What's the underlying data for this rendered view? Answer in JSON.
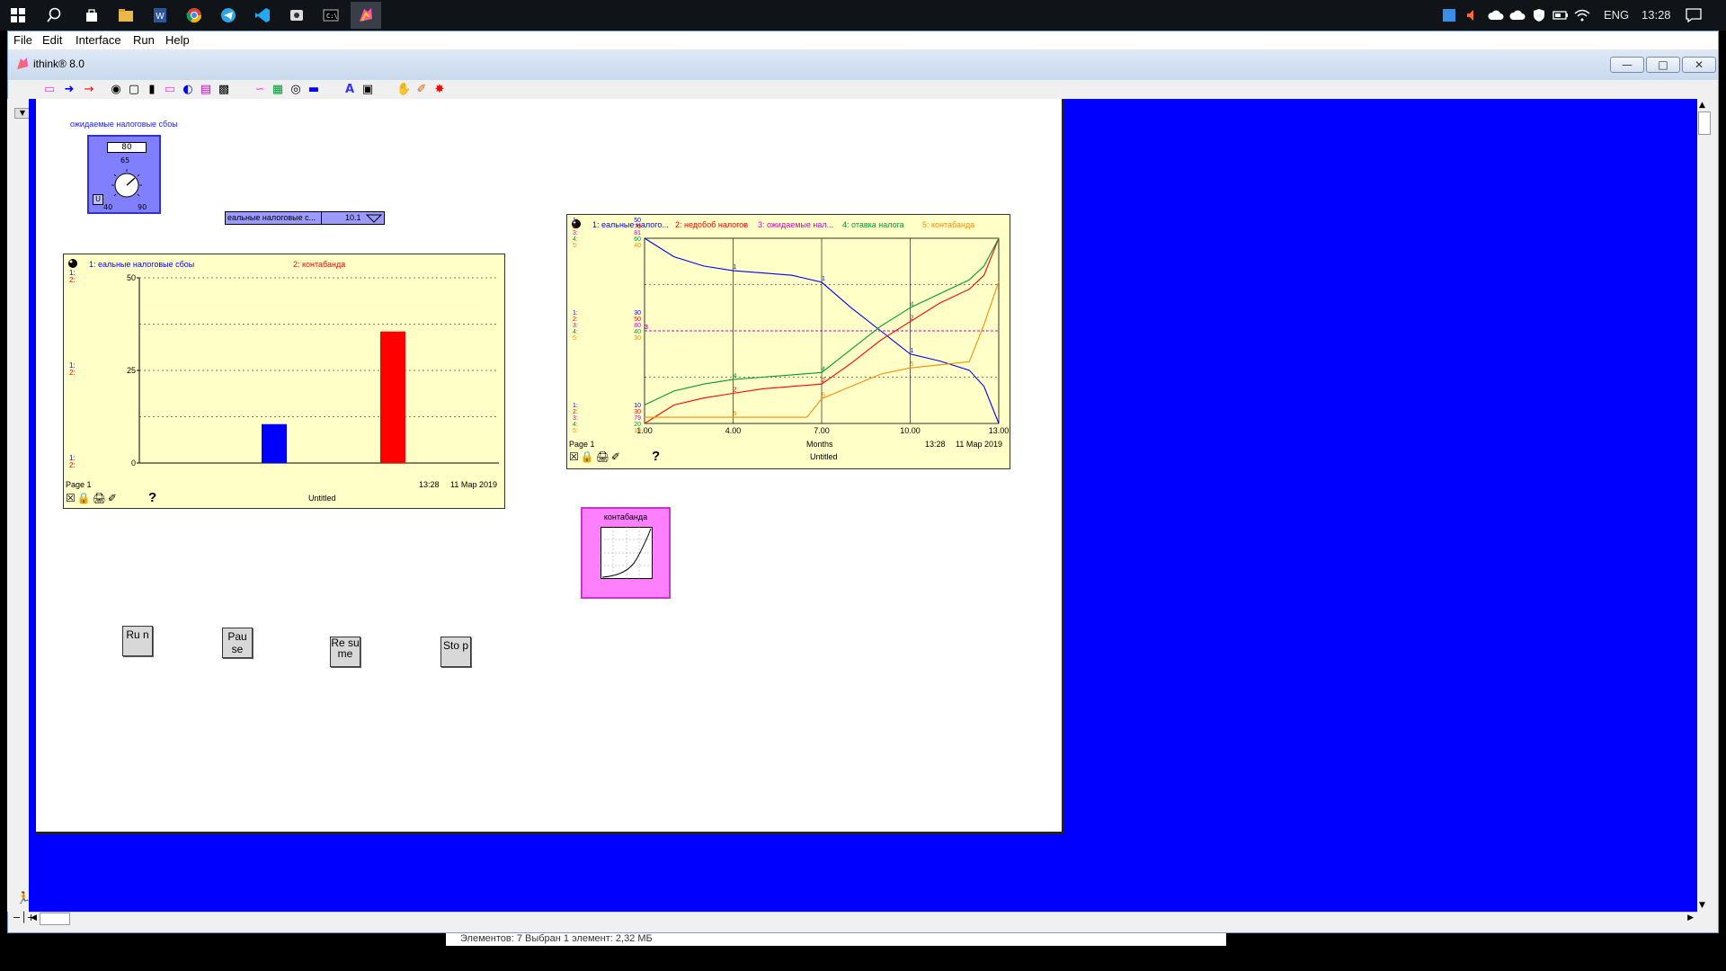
{
  "taskbar": {
    "tray_lang": "ENG",
    "tray_time": "13:28"
  },
  "menubar": {
    "file": "File",
    "edit": "Edit",
    "interface": "Interface",
    "run": "Run",
    "help": "Help"
  },
  "window": {
    "title": "ithink® 8.0"
  },
  "knob": {
    "label": "ожидаемые налоговые сбоы",
    "value": "80",
    "mid": "65",
    "min": "40",
    "max": "90",
    "unit_btn": "U"
  },
  "dropdown": {
    "label": "еальные налоговые с...",
    "value": "10.1"
  },
  "bar_graph": {
    "legend1": "1: еальные налоговые сбоы",
    "legend2": "2: контабанда",
    "page": "Page 1",
    "time": "13:28",
    "date": "11 Мар 2019",
    "name": "Untitled",
    "help": "?",
    "y_ticks": [
      "50",
      "25",
      "0"
    ],
    "ax_1": "1:",
    "ax_2": "2:",
    "chart_data": {
      "type": "bar",
      "categories": [
        "1",
        "2"
      ],
      "values": [
        10.5,
        35.5
      ],
      "ylim": [
        0,
        50
      ]
    }
  },
  "line_graph": {
    "legend1": "1: еальные налого...",
    "legend2": "2: недобоб налогов",
    "legend3": "3: ожидаемые нал...",
    "legend4": "4: отавка налога",
    "legend5": "5: контабанда",
    "page": "Page 1",
    "time": "13:28",
    "date": "11 Мар 2019",
    "name": "Untitled",
    "xlabel": "Months",
    "help": "?",
    "x_ticks": [
      "1.00",
      "4.00",
      "7.00",
      "10.00",
      "13.00"
    ],
    "top_ticks": [
      "50",
      "70",
      "81",
      "60",
      "40"
    ],
    "mid_ticks": [
      "30",
      "50",
      "80",
      "40",
      "30"
    ],
    "bot_ticks": [
      "10",
      "30",
      "79",
      "20",
      "10"
    ],
    "ax": [
      "1:",
      "2:",
      "3:",
      "4:",
      "5:"
    ],
    "colors": [
      "#0000ff",
      "#ff0000",
      "#cc00cc",
      "#009933",
      "#ff8800"
    ],
    "chart_data": {
      "type": "line",
      "xlim": [
        1,
        13
      ],
      "series": [
        {
          "name": "еальные налого...",
          "x": [
            1,
            2,
            3,
            4,
            5,
            6,
            7,
            8,
            9,
            10,
            11,
            12,
            12.5,
            13
          ],
          "y": [
            50,
            46,
            44,
            43,
            42.5,
            42,
            40.5,
            35,
            30,
            25,
            23.5,
            21.5,
            18,
            10
          ]
        },
        {
          "name": "недобоб налогов",
          "x": [
            1,
            2,
            3,
            4,
            5,
            6,
            7,
            8,
            9,
            10,
            11,
            12,
            12.5,
            13
          ],
          "y": [
            30,
            34,
            35.5,
            36.5,
            37.5,
            38,
            38.5,
            43,
            48,
            52,
            56,
            59,
            62,
            70
          ]
        },
        {
          "name": "ожидаемые нал...",
          "x": [
            1,
            13
          ],
          "y": [
            80,
            80
          ]
        },
        {
          "name": "отавка налога",
          "x": [
            1,
            2,
            3,
            4,
            5,
            6,
            7,
            8,
            9,
            10,
            11,
            12,
            12.5,
            13
          ],
          "y": [
            24,
            27,
            28.5,
            29.5,
            30,
            30.5,
            31,
            36,
            41,
            45,
            48,
            51,
            54,
            60
          ]
        },
        {
          "name": "контабанда",
          "x": [
            1,
            2,
            3,
            4,
            5,
            6,
            6.5,
            7,
            8,
            9,
            10,
            11,
            12,
            12.5,
            13
          ],
          "y": [
            11,
            11,
            11,
            11,
            11,
            11,
            11,
            14,
            16,
            18,
            19,
            19.5,
            20,
            26,
            33
          ]
        }
      ]
    }
  },
  "buttons": {
    "run": "Ru n",
    "pause": "Pau se",
    "resume": "Re su me",
    "stop": "Sto p"
  },
  "graphical_function": {
    "label": "контабанда"
  },
  "bottom_strip": {
    "text": "Элементов: 7      Выбран 1 элемент: 2,32 МБ"
  }
}
